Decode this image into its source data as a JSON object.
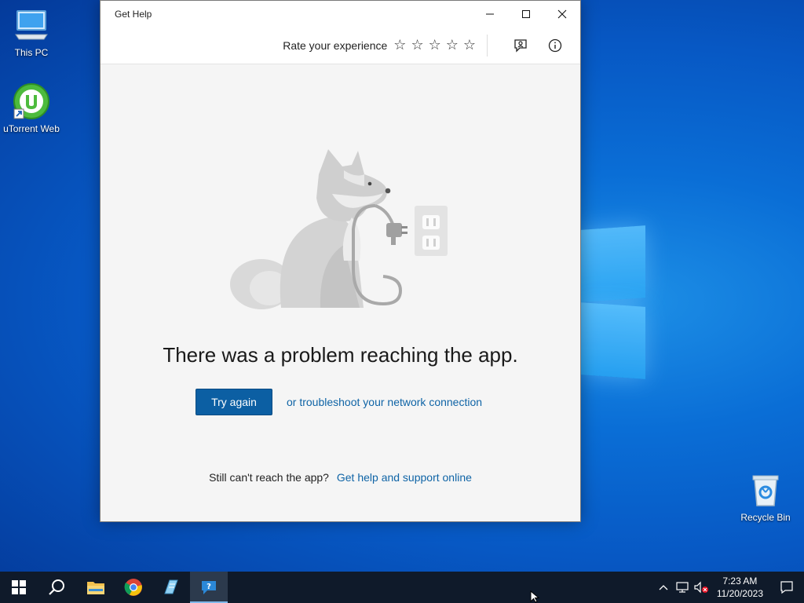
{
  "desktop": {
    "icons": [
      {
        "label": "This PC"
      },
      {
        "label": "uTorrent Web"
      },
      {
        "label": "Recycle Bin"
      }
    ]
  },
  "window": {
    "title": "Get Help",
    "header": {
      "rate_label": "Rate your experience",
      "stars": 5,
      "icons": [
        "feedback-icon",
        "info-icon"
      ]
    },
    "content": {
      "headline": "There was a problem reaching the app.",
      "try_again_label": "Try again",
      "troubleshoot_link": "or troubleshoot your network connection",
      "still_text": "Still can't reach the app?",
      "support_link": "Get help and support online"
    }
  },
  "taskbar": {
    "pinned": [
      "start-icon",
      "search-icon",
      "file-explorer-icon",
      "chrome-icon",
      "notepad-icon",
      "get-help-icon"
    ],
    "active": "get-help-icon",
    "clock": {
      "time": "7:23 AM",
      "date": "11/20/2023"
    }
  },
  "colors": {
    "accent_button": "#0c5fa3",
    "link": "#0f64a6",
    "taskbar": "#0f1a2a"
  }
}
